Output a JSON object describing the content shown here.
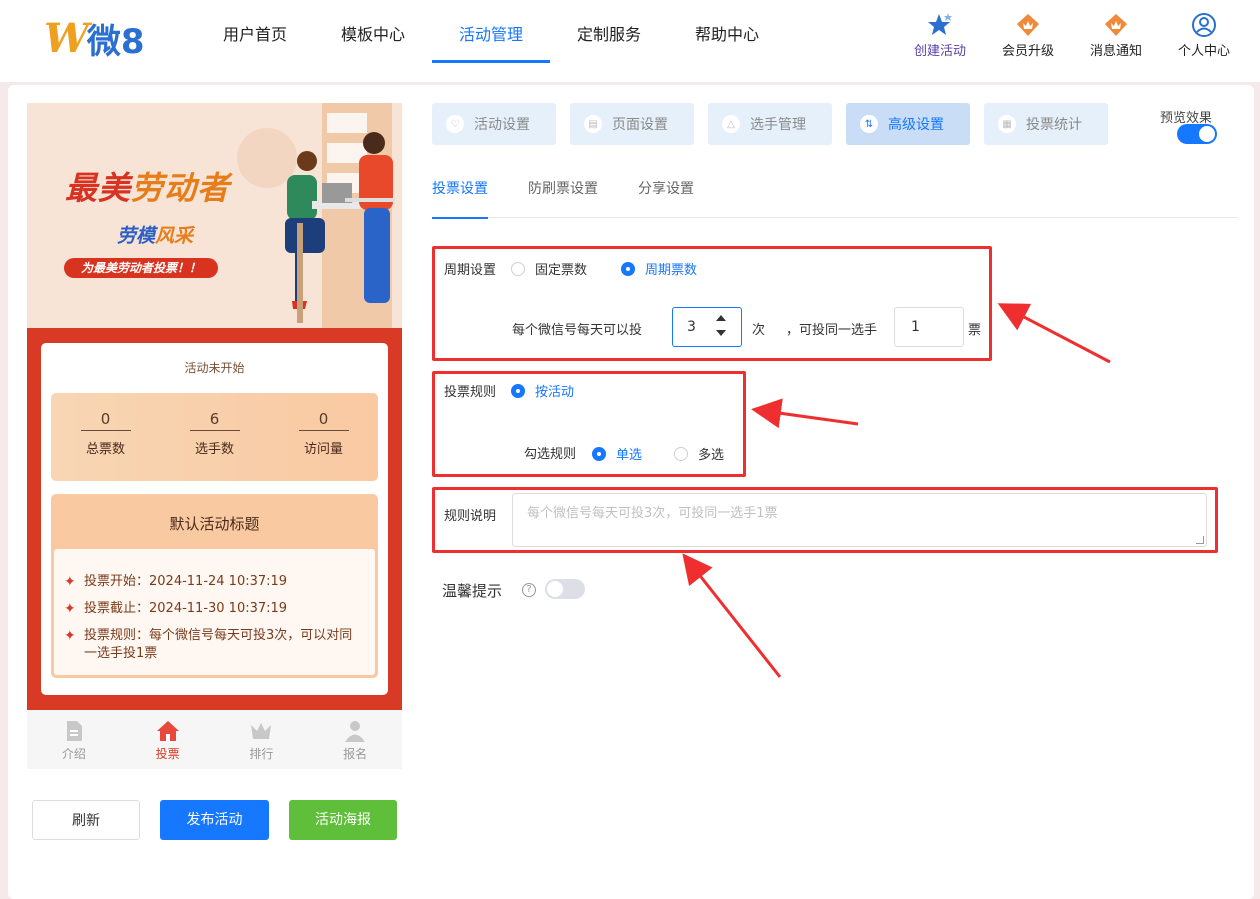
{
  "logo": {
    "mark": "W",
    "text": "微8"
  },
  "nav": [
    "用户首页",
    "模板中心",
    "活动管理",
    "定制服务",
    "帮助中心"
  ],
  "nav_active": "活动管理",
  "header_right": [
    {
      "label": "创建活动",
      "icon": "create-star-icon"
    },
    {
      "label": "会员升级",
      "icon": "crown-badge-icon"
    },
    {
      "label": "消息通知",
      "icon": "crown-badge-icon"
    },
    {
      "label": "个人中心",
      "icon": "user-icon"
    }
  ],
  "banner": {
    "title_a": "最美",
    "title_b": "劳动者",
    "subtitle_a": "劳模",
    "subtitle_b": "风采",
    "slogan": "为最美劳动者投票！！"
  },
  "preview_card": {
    "status": "活动未开始",
    "stats": [
      {
        "value": "0",
        "label": "总票数"
      },
      {
        "value": "6",
        "label": "选手数"
      },
      {
        "value": "0",
        "label": "访问量"
      }
    ],
    "activity_title": "默认活动标题",
    "rules": [
      "投票开始：2024-11-24 10:37:19",
      "投票截止：2024-11-30 10:37:19",
      "投票规则：每个微信号每天可投3次，可以对同一选手投1票"
    ]
  },
  "bottom_nav": [
    {
      "label": "介绍",
      "icon": "document-icon"
    },
    {
      "label": "投票",
      "icon": "home-icon"
    },
    {
      "label": "排行",
      "icon": "crown-icon"
    },
    {
      "label": "报名",
      "icon": "person-icon"
    }
  ],
  "buttons": {
    "refresh": "刷新",
    "publish": "发布活动",
    "poster": "活动海报"
  },
  "steps": [
    "活动设置",
    "页面设置",
    "选手管理",
    "高级设置",
    "投票统计"
  ],
  "steps_active": "高级设置",
  "preview_toggle": {
    "label": "预览效果",
    "on": true
  },
  "subtabs": [
    "投票设置",
    "防刷票设置",
    "分享设置"
  ],
  "subtabs_active": "投票设置",
  "form": {
    "cycle_label": "周期设置",
    "cycle_options": [
      "固定票数",
      "周期票数"
    ],
    "cycle_selected": "周期票数",
    "per_day_prefix": "每个微信号每天可以投",
    "per_day_value": "3",
    "per_day_unit": "次",
    "same_player_prefix": "，可投同一选手",
    "same_player_value": "1",
    "same_player_unit": "票",
    "rule_label": "投票规则",
    "rule_option": "按活动",
    "check_rule_label": "勾选规则",
    "check_options": [
      "单选",
      "多选"
    ],
    "check_selected": "单选",
    "desc_label": "规则说明",
    "desc_placeholder": "每个微信号每天可投3次，可投同一选手1票",
    "tip_label": "温馨提示",
    "tip_on": false
  },
  "colors": {
    "accent": "#1677ff",
    "annotation": "#ef2f2f",
    "banner_red": "#d93a26",
    "poster_green": "#5fbf3a"
  }
}
